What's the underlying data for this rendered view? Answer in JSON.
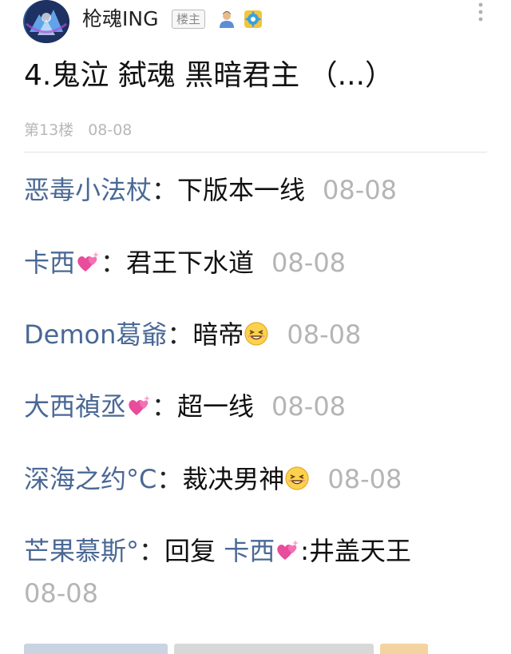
{
  "header": {
    "username": "枪魂ING",
    "op_badge": "楼主"
  },
  "post": {
    "text": "4.鬼泣 弑魂 黑暗君主 （...）",
    "floor": "第13楼",
    "date": "08-08"
  },
  "replies": [
    {
      "name": "恶毒小法杖",
      "colon": "：",
      "content": "下版本一线",
      "time": "08-08"
    },
    {
      "name": "卡西",
      "name_emoji": "sparkling-heart-emoji",
      "colon": "：",
      "content": "君王下水道",
      "time": "08-08"
    },
    {
      "name": "Demon葛爺",
      "colon": "：",
      "content": "暗帝",
      "content_emoji": "grinning-squint-emoji",
      "time": "08-08"
    },
    {
      "name": "大西禎丞",
      "name_emoji": "sparkling-heart-emoji",
      "colon": "：",
      "content": "超一线",
      "time": "08-08"
    },
    {
      "name": "深海之约°C",
      "colon": "：",
      "content": "裁决男神",
      "content_emoji": "grinning-squint-emoji",
      "time": "08-08"
    },
    {
      "name": "芒果慕斯°",
      "colon": "：",
      "reply_prefix": "回复 ",
      "reply_target": "卡西",
      "target_emoji": "sparkling-heart-emoji",
      "content": ":井盖天王",
      "time": "08-08"
    }
  ],
  "colors": {
    "name_blue": "#4a6895",
    "time_gray": "#b5b5b5",
    "text_black": "#111111"
  }
}
